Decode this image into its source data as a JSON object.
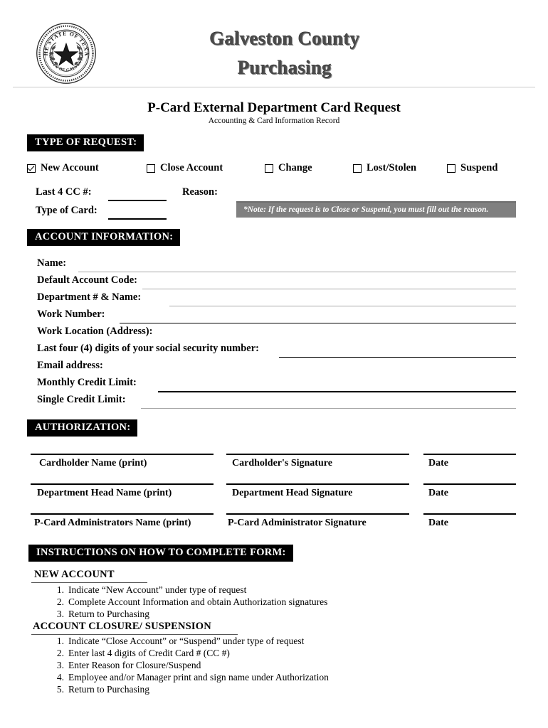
{
  "header": {
    "seal": {
      "top_text": "THE STATE OF TEXAS",
      "bottom_text": "COUNTY OF GALVESTON"
    },
    "org_line1": "Galveston County",
    "org_line2": "Purchasing"
  },
  "document": {
    "title": "P-Card External Department Card Request",
    "subtitle": "Accounting & Card Information Record"
  },
  "type_of_request": {
    "section_title": "TYPE OF REQUEST:",
    "options": [
      {
        "label": "New Account",
        "checked": true
      },
      {
        "label": "Close Account",
        "checked": false
      },
      {
        "label": "Change",
        "checked": false
      },
      {
        "label": "Lost/Stolen",
        "checked": false
      },
      {
        "label": "Suspend",
        "checked": false
      }
    ],
    "last4_label": "Last 4 CC #:",
    "type_of_card_label": "Type of Card:",
    "reason_label": "Reason:",
    "note": "*Note:  If the request is to Close or Suspend, you must fill out the reason."
  },
  "account_information": {
    "section_title": "ACCOUNT INFORMATION:",
    "fields": [
      "Name:",
      "Default Account Code:",
      "Department # & Name:",
      "Work Number:",
      "Work Location (Address):",
      "Last four (4) digits of your social security number:",
      "Email address:",
      "Monthly Credit Limit:",
      "Single Credit Limit:"
    ]
  },
  "authorization": {
    "section_title": "AUTHORIZATION:",
    "rows": [
      {
        "name": "Cardholder Name (print)",
        "signature": "Cardholder's Signature",
        "date": "Date"
      },
      {
        "name": "Department Head Name (print)",
        "signature": "Department Head Signature",
        "date": "Date"
      },
      {
        "name": "P-Card Administrators Name (print)",
        "signature": "P-Card Administrator Signature",
        "date": "Date"
      }
    ]
  },
  "instructions": {
    "section_title": "INSTRUCTIONS ON HOW TO COMPLETE FORM:",
    "groups": [
      {
        "heading": "NEW ACCOUNT",
        "steps": [
          "Indicate “New Account” under type of request",
          "Complete Account Information and obtain Authorization signatures",
          "Return to Purchasing"
        ]
      },
      {
        "heading": "ACCOUNT CLOSURE/ SUSPENSION",
        "steps": [
          "Indicate “Close Account” or “Suspend” under type of request",
          "Enter last 4 digits of Credit Card # (CC #)",
          "Enter Reason for Closure/Suspend",
          "Employee and/or Manager print and sign name under Authorization",
          "Return to Purchasing"
        ]
      }
    ],
    "numbers": [
      "1.",
      "2.",
      "3.",
      "4.",
      "5."
    ]
  }
}
